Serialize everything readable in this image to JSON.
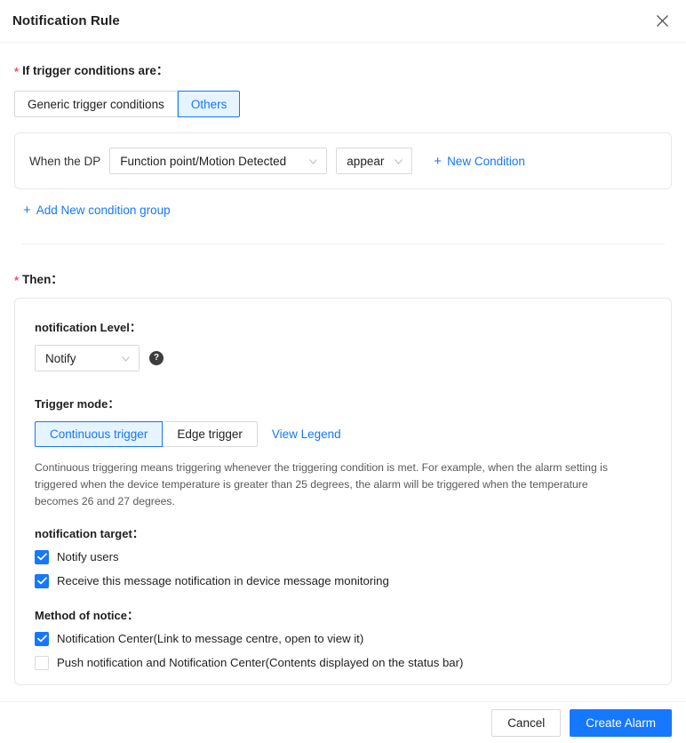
{
  "header": {
    "title": "Notification Rule",
    "close_icon": "close-icon"
  },
  "trigger_section": {
    "label": "If trigger conditions are：",
    "required_marker": "*",
    "tabs": [
      {
        "label": "Generic trigger conditions",
        "active": false
      },
      {
        "label": "Others",
        "active": true
      }
    ],
    "condition_group": {
      "prefix": "When the DP",
      "dp_select": {
        "value": "Function point/Motion Detected",
        "caret_icon": "chevron-down-icon"
      },
      "operator_select": {
        "value": "appear",
        "caret_icon": "chevron-down-icon"
      },
      "new_condition_link": {
        "plus": "+",
        "label": "New Condition"
      }
    },
    "add_group_link": {
      "plus": "+",
      "label": "Add New condition group"
    }
  },
  "then_section": {
    "label": "Then：",
    "required_marker": "*",
    "notification_level": {
      "label": "notification Level：",
      "value": "Notify",
      "caret_icon": "chevron-down-icon",
      "help_icon": "?"
    },
    "trigger_mode": {
      "label": "Trigger mode：",
      "options": [
        {
          "label": "Continuous trigger",
          "active": true
        },
        {
          "label": "Edge trigger",
          "active": false
        }
      ],
      "legend_link": "View Legend",
      "description": "Continuous triggering means triggering whenever the triggering condition is met. For example, when the alarm setting is triggered when the device temperature is greater than 25 degrees, the alarm will be triggered when the temperature becomes 26 and 27 degrees."
    },
    "notification_target": {
      "label": "notification target：",
      "items": [
        {
          "label": "Notify users",
          "checked": true
        },
        {
          "label": "Receive this message notification in device message monitoring",
          "checked": true
        }
      ]
    },
    "method_of_notice": {
      "label": "Method of notice：",
      "items": [
        {
          "label": "Notification Center(Link to message centre, open to view it)",
          "checked": true
        },
        {
          "label": "Push notification and Notification Center(Contents displayed on the status bar)",
          "checked": false
        }
      ]
    }
  },
  "footer": {
    "cancel_label": "Cancel",
    "submit_label": "Create Alarm"
  },
  "colors": {
    "accent": "#1677ff",
    "accent_bg": "#e6f4ff",
    "required": "#ff4d4f",
    "border": "#d9d9d9",
    "help_bg": "#3d3d3d"
  }
}
